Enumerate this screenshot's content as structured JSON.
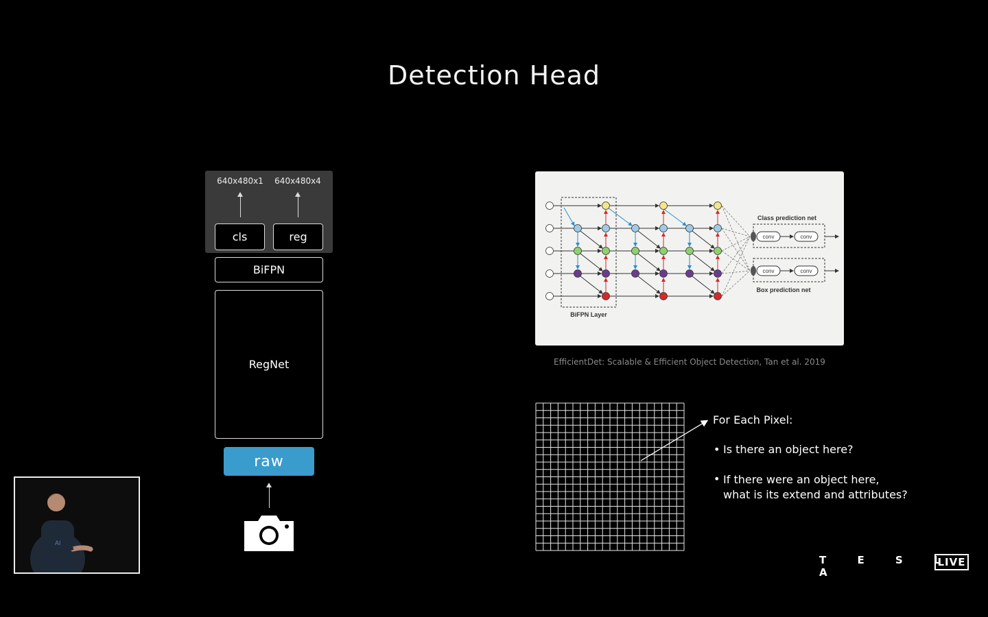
{
  "title": "Detection Head",
  "pipeline": {
    "output_dims": [
      "640x480x1",
      "640x480x4"
    ],
    "heads": [
      "cls",
      "reg"
    ],
    "neck": "BiFPN",
    "backbone": "RegNet",
    "input": "raw",
    "input_color": "#3a9ccc",
    "camera_icon": "camera-icon"
  },
  "diagram": {
    "class_net_label": "Class prediction net",
    "box_net_label": "Box prediction net",
    "bifpn_label": "BiFPN Layer",
    "conv_label": "conv",
    "node_colors": [
      "#ffffff",
      "#f3e58a",
      "#9ecbe6",
      "#8fd070",
      "#6a3d8a",
      "#d42a2a"
    ]
  },
  "caption": "EfficientDet: Scalable & Efficient Object Detection, Tan et al. 2019",
  "pixel_panel": {
    "heading": "For Each Pixel:",
    "bullets": [
      "Is there an object here?",
      "If there were an object here,\nwhat is its extend and attributes?"
    ]
  },
  "branding": {
    "logo": "T E S L A",
    "live": "LIVE"
  },
  "presenter_video": "presenter-video"
}
